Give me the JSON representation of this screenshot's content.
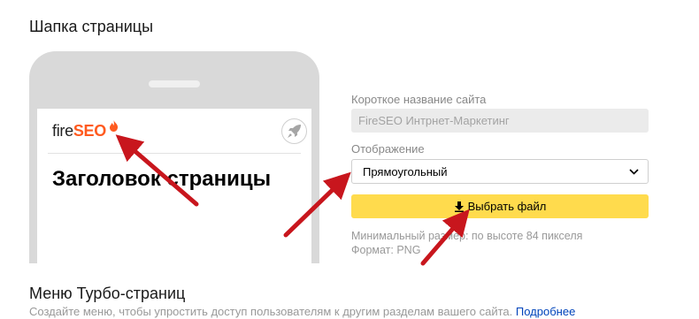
{
  "header_section": {
    "title": "Шапка страницы"
  },
  "preview": {
    "logo_text_part1": "fire",
    "logo_text_part2": "SEO",
    "icon": "rocket-icon",
    "page_heading": "Заголовок страницы"
  },
  "form": {
    "site_name_label": "Короткое название сайта",
    "site_name_value": "FireSEO Интрнет-Маркетинг",
    "display_label": "Отображение",
    "display_value": "Прямоугольный",
    "upload_button": "Выбрать файл",
    "hint_min_size": "Минимальный размер: по высоте 84 пикселя",
    "hint_format": "Формат: PNG"
  },
  "menu_section": {
    "title": "Меню Турбо-страниц",
    "description": "Создайте меню, чтобы упростить доступ пользователям к другим разделам вашего сайта.",
    "link": "Подробнее"
  },
  "colors": {
    "accent_yellow": "#ffdb4d",
    "logo_orange": "#ff5a1f",
    "arrow_red": "#c8161d",
    "link_blue": "#0044bb"
  }
}
